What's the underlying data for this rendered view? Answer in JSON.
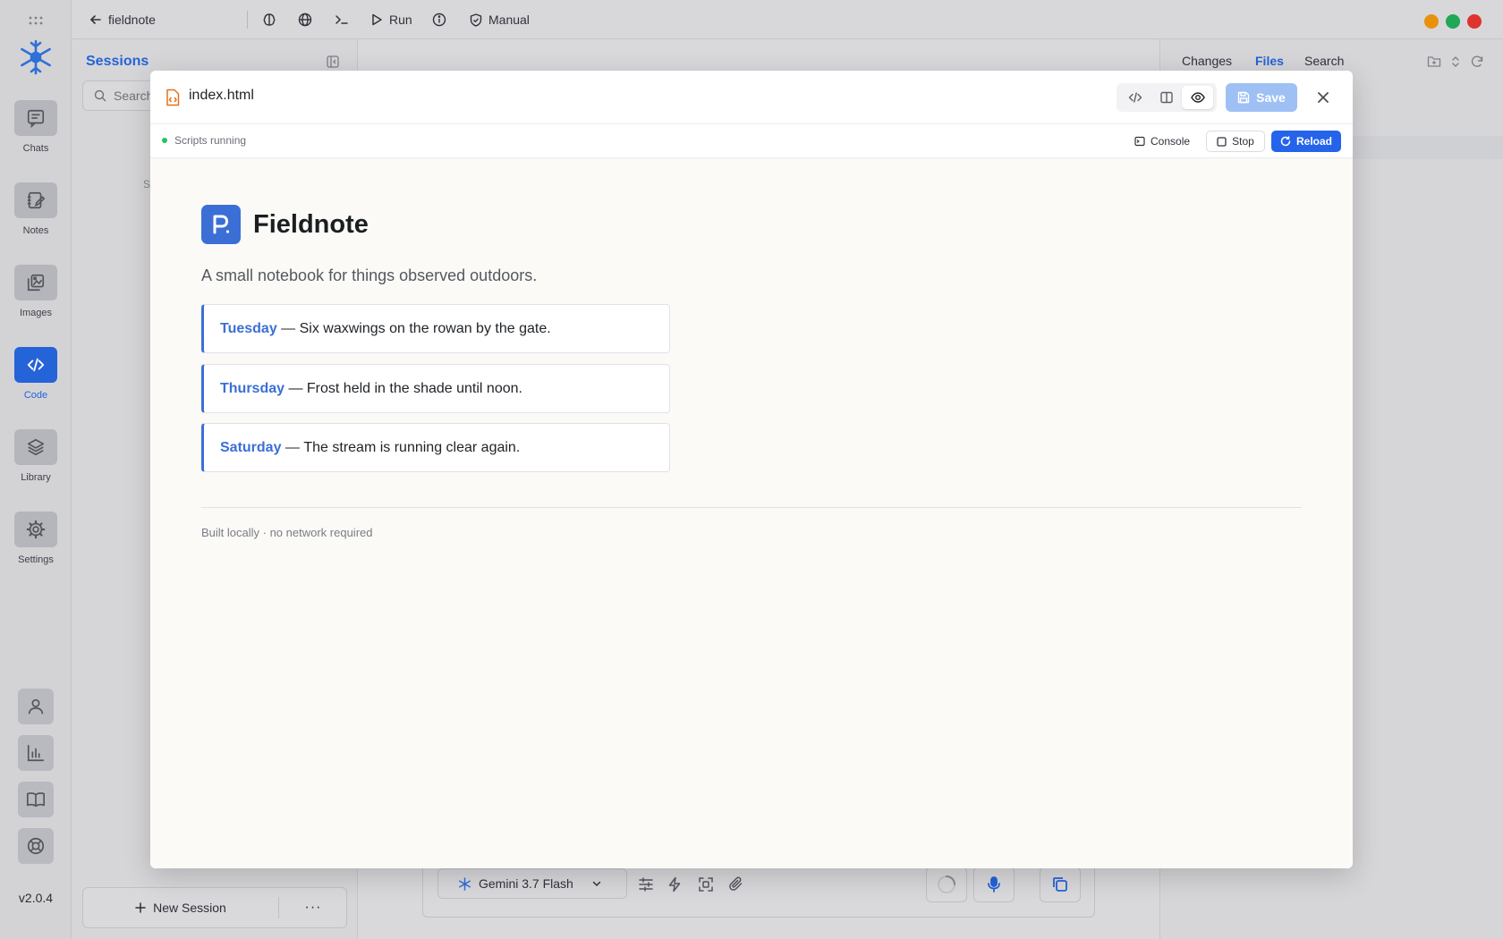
{
  "app": {
    "version": "v2.0.4",
    "rail": [
      {
        "label": "Chats",
        "icon": "chat-icon"
      },
      {
        "label": "Notes",
        "icon": "notebook-edit-icon"
      },
      {
        "label": "Images",
        "icon": "images-icon"
      },
      {
        "label": "Code",
        "icon": "code-icon",
        "active": true
      },
      {
        "label": "Library",
        "icon": "layers-icon"
      },
      {
        "label": "Settings",
        "icon": "gear-icon"
      }
    ],
    "rail_bottom_icons": [
      "user-icon",
      "bar-chart-icon",
      "book-open-icon",
      "lifebuoy-icon"
    ]
  },
  "topbar": {
    "back_label": "fieldnote",
    "run_label": "Run",
    "mode_label": "Manual",
    "window_controls": {
      "minimize": "#e8920c",
      "maximize": "#1fa855",
      "close": "#e0322e"
    }
  },
  "sessions": {
    "title": "Sessions",
    "search_placeholder": "Search",
    "empty_hint": "S",
    "new_session_label": "New Session",
    "more_label": "···"
  },
  "composer": {
    "model_label": "Gemini 3.7 Flash"
  },
  "right_panel": {
    "tabs": [
      {
        "label": "Changes"
      },
      {
        "label": "Files",
        "active": true
      },
      {
        "label": "Search"
      }
    ]
  },
  "modal": {
    "file_name": "index.html",
    "save_label": "Save",
    "status_text": "Scripts running",
    "console_label": "Console",
    "stop_label": "Stop",
    "reload_label": "Reload",
    "accent_color": "#2563eb"
  },
  "preview": {
    "brand_name": "Fieldnote",
    "tagline": "A small notebook for things observed outdoors.",
    "separator": " — ",
    "notes": [
      {
        "day": "Tuesday",
        "text": "Six waxwings on the rowan by the gate."
      },
      {
        "day": "Thursday",
        "text": "Frost held in the shade until noon."
      },
      {
        "day": "Saturday",
        "text": "The stream is running clear again."
      }
    ],
    "footer": "Built locally · no network required",
    "brand_color": "#3b6fd6"
  }
}
